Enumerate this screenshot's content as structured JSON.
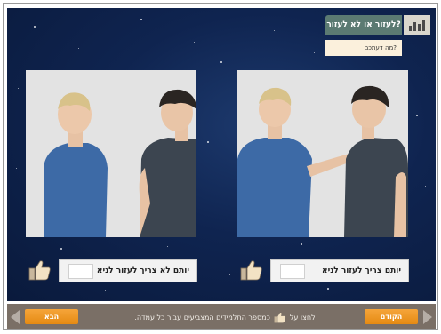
{
  "header": {
    "title": "לעזור או לא לעזור?",
    "question": "מה דעתכם?",
    "logo_icon": "bar-chart-icon"
  },
  "colors": {
    "space_bg": "#0f2450",
    "title_bg": "#5b7a72",
    "question_bg": "#fbf0dc",
    "bottom_bar": "#7a6f66",
    "button_orange": "#f39a22"
  },
  "options": [
    {
      "label": "יותם לא צריך לעזור לניא",
      "votes": ""
    },
    {
      "label": "יותם צריך לעזור לניא",
      "votes": ""
    }
  ],
  "footer": {
    "instruction_before": "לחצו על",
    "instruction_after": "כמספר התלמידים המצביעים עבור כל עמדה.",
    "next_label": "הבא",
    "prev_label": "הקודם"
  }
}
